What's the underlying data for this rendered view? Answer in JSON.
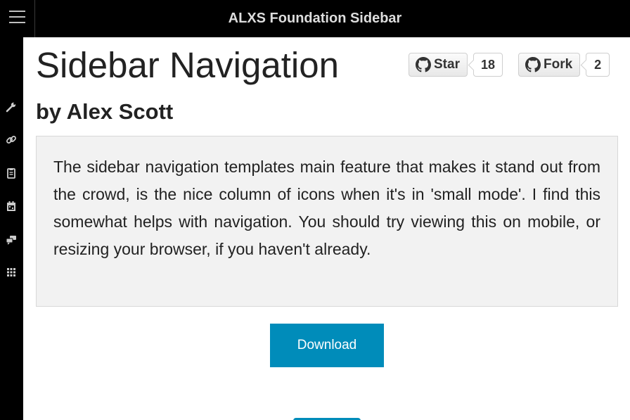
{
  "header": {
    "title": "ALXS Foundation Sidebar",
    "menu_icon": "hamburger-menu-icon"
  },
  "sidebar": {
    "items": [
      {
        "icon": "wrench-icon"
      },
      {
        "icon": "link-icon"
      },
      {
        "icon": "clipboard-icon"
      },
      {
        "icon": "calendar-icon"
      },
      {
        "icon": "chat-icon"
      },
      {
        "icon": "grid-icon"
      }
    ]
  },
  "main": {
    "title": "Sidebar Navigation",
    "subtitle": "by Alex Scott",
    "description": "The sidebar navigation templates main feature that makes it stand out from the crowd, is the nice column of icons when it's in 'small mode'. I find this somewhat helps with navigation. You should try viewing this on mobile, or resizing your browser, if you haven't already.",
    "download_label": "Download"
  },
  "github": {
    "star_label": "Star",
    "star_count": "18",
    "fork_label": "Fork",
    "fork_count": "2"
  },
  "colors": {
    "topbar": "#000000",
    "accent": "#008cba",
    "panel": "#f2f2f2"
  }
}
